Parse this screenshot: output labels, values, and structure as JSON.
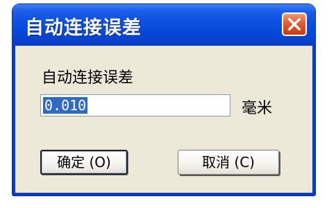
{
  "window": {
    "title": "自动连接误差"
  },
  "form": {
    "label": "自动连接误差",
    "value": "0.010",
    "unit": "毫米"
  },
  "buttons": {
    "ok_label": "确定",
    "ok_key": "(O)",
    "cancel_label": "取消",
    "cancel_key": "(C)"
  },
  "colors": {
    "titlebar": "#0a4ee0",
    "client": "#ece9d8",
    "selection": "#316ac5",
    "close": "#e25b30"
  },
  "icons": {
    "close": "close-icon"
  }
}
